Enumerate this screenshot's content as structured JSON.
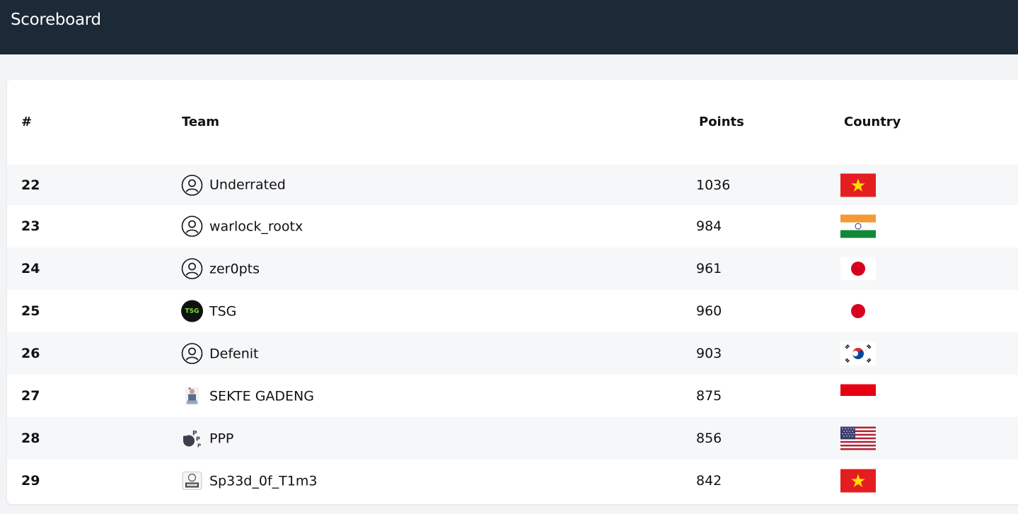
{
  "header": {
    "title": "Scoreboard"
  },
  "table": {
    "columns": {
      "rank": "#",
      "team": "Team",
      "points": "Points",
      "country": "Country"
    },
    "rows": [
      {
        "rank": "22",
        "team": "Underrated",
        "points": "1036",
        "avatar": "user-circle-icon",
        "flag": "vietnam-flag-icon"
      },
      {
        "rank": "23",
        "team": "warlock_rootx",
        "points": "984",
        "avatar": "user-circle-icon",
        "flag": "india-flag-icon"
      },
      {
        "rank": "24",
        "team": "zer0pts",
        "points": "961",
        "avatar": "user-circle-icon",
        "flag": "japan-flag-icon"
      },
      {
        "rank": "25",
        "team": "TSG",
        "points": "960",
        "avatar": "tsg-logo-icon",
        "avatar_text": "TSG",
        "flag": "japan-flag-icon"
      },
      {
        "rank": "26",
        "team": "Defenit",
        "points": "903",
        "avatar": "user-circle-icon",
        "flag": "south-korea-flag-icon"
      },
      {
        "rank": "27",
        "team": "SEKTE GADENG",
        "points": "875",
        "avatar": "team-logo-icon",
        "flag": "indonesia-flag-icon"
      },
      {
        "rank": "28",
        "team": "PPP",
        "points": "856",
        "avatar": "ppp-logo-icon",
        "flag": "usa-flag-icon"
      },
      {
        "rank": "29",
        "team": "Sp33d_0f_T1m3",
        "points": "842",
        "avatar": "uit-logo-icon",
        "flag": "vietnam-flag-icon"
      }
    ]
  },
  "colors": {
    "header_bg": "#1c2937",
    "page_bg": "#f3f4f6",
    "row_alt": "#f6f7f9",
    "tsg_green": "#7ee03b"
  }
}
